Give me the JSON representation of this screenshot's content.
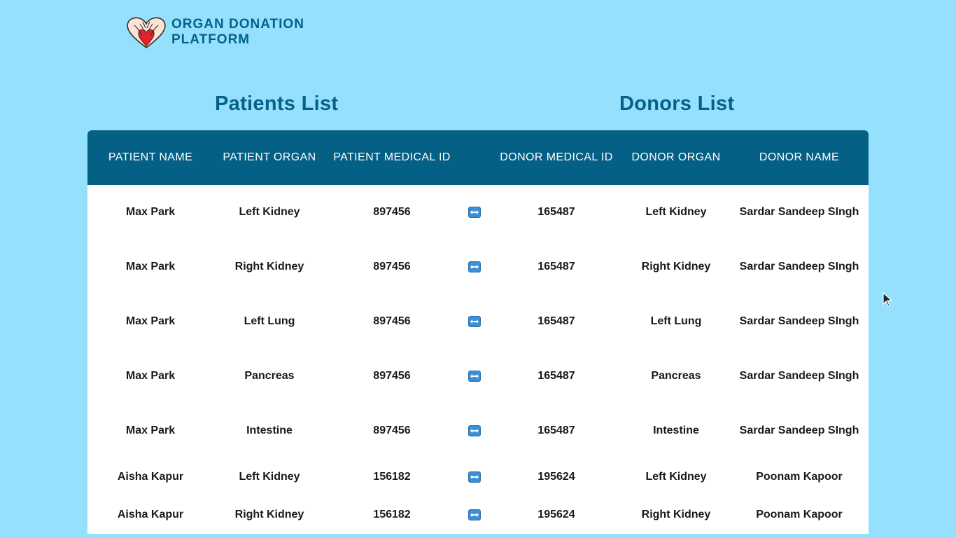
{
  "brand": {
    "line1": "ORGAN DONATION",
    "line2": "PLATFORM",
    "logo_icon": "heart-hands-icon"
  },
  "titles": {
    "patients": "Patients List",
    "donors": "Donors List"
  },
  "headers": {
    "patient_name": "PATIENT NAME",
    "patient_organ": "PATIENT ORGAN",
    "patient_medical_id": "PATIENT MEDICAL ID",
    "swap": "",
    "donor_medical_id": "DONOR MEDICAL ID",
    "donor_organ": "DONOR ORGAN",
    "donor_name": "DONOR NAME"
  },
  "rows": [
    {
      "patient_name": "Max Park",
      "patient_organ": "Left Kidney",
      "patient_id": "897456",
      "donor_id": "165487",
      "donor_organ": "Left Kidney",
      "donor_name": "Sardar Sandeep SIngh"
    },
    {
      "patient_name": "Max Park",
      "patient_organ": "Right Kidney",
      "patient_id": "897456",
      "donor_id": "165487",
      "donor_organ": "Right Kidney",
      "donor_name": "Sardar Sandeep SIngh"
    },
    {
      "patient_name": "Max Park",
      "patient_organ": "Left Lung",
      "patient_id": "897456",
      "donor_id": "165487",
      "donor_organ": "Left Lung",
      "donor_name": "Sardar Sandeep SIngh"
    },
    {
      "patient_name": "Max Park",
      "patient_organ": "Pancreas",
      "patient_id": "897456",
      "donor_id": "165487",
      "donor_organ": "Pancreas",
      "donor_name": "Sardar Sandeep SIngh"
    },
    {
      "patient_name": "Max Park",
      "patient_organ": "Intestine",
      "patient_id": "897456",
      "donor_id": "165487",
      "donor_organ": "Intestine",
      "donor_name": "Sardar Sandeep SIngh"
    },
    {
      "patient_name": "Aisha Kapur",
      "patient_organ": "Left Kidney",
      "patient_id": "156182",
      "donor_id": "195624",
      "donor_organ": "Left Kidney",
      "donor_name": "Poonam Kapoor"
    },
    {
      "patient_name": "Aisha Kapur",
      "patient_organ": "Right Kidney",
      "patient_id": "156182",
      "donor_id": "195624",
      "donor_organ": "Right Kidney",
      "donor_name": "Poonam Kapoor"
    }
  ],
  "colors": {
    "background": "#95e1fd",
    "header_bg": "#046084",
    "title": "#056187",
    "swap_icon": "#3a8fd6"
  },
  "icons": {
    "swap": "swap-arrows-icon",
    "cursor": "mouse-cursor-icon"
  }
}
